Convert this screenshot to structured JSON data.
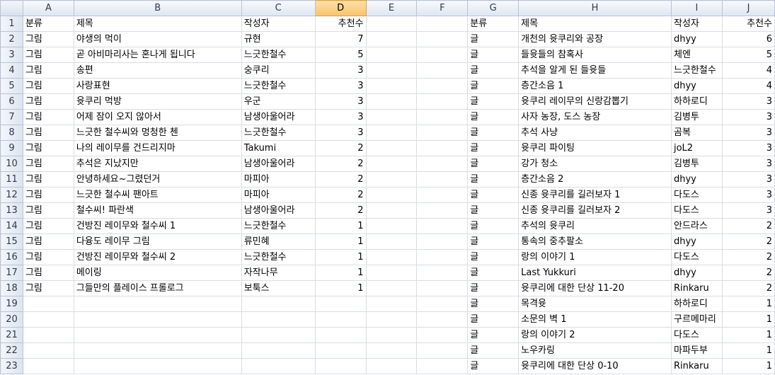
{
  "columns": [
    "A",
    "B",
    "C",
    "D",
    "E",
    "F",
    "G",
    "H",
    "I",
    "J"
  ],
  "selected_column": "D",
  "header_row": {
    "A": "분류",
    "B": "제목",
    "C": "작성자",
    "D": "추천수",
    "G": "분류",
    "H": "제목",
    "I": "작성자",
    "J": "추천수"
  },
  "left_rows": [
    [
      "그림",
      "야생의 먹이",
      "규현",
      "7"
    ],
    [
      "그림",
      "곧 아비마리사는 혼나게 됩니다",
      "느긋한철수",
      "5"
    ],
    [
      "그림",
      "송편",
      "숭쿠리",
      "3"
    ],
    [
      "그림",
      "사랑표현",
      "느긋한철수",
      "3"
    ],
    [
      "그림",
      "윳쿠리 먹방",
      "우군",
      "3"
    ],
    [
      "그림",
      "어제 잠이 오지 않아서",
      "남생아울어라",
      "3"
    ],
    [
      "그림",
      "느긋한 철수씨와 멍청한 첸",
      "느긋한철수",
      "3"
    ],
    [
      "그림",
      "나의 레이무를 건드리지마",
      "Takumi",
      "2"
    ],
    [
      "그림",
      "추석은 지났지만",
      "남생아울어라",
      "2"
    ],
    [
      "그림",
      "안녕하세요~그렸던거",
      "마피아",
      "2"
    ],
    [
      "그림",
      "느긋한 철수씨 팬아트",
      "마피아",
      "2"
    ],
    [
      "그림",
      "철수씨! 파란색",
      "남생아울어라",
      "2"
    ],
    [
      "그림",
      "건방진 레이무와 철수씨 1",
      "느긋한철수",
      "1"
    ],
    [
      "그림",
      "다융도 레이무 그림",
      "류민혜",
      "1"
    ],
    [
      "그림",
      "건방진 레이무와 철수씨 2",
      "느긋한철수",
      "1"
    ],
    [
      "그림",
      "메이링",
      "자작나무",
      "1"
    ],
    [
      "그림",
      "그들만의 플레이스 프롤로그",
      "보툭스",
      "1"
    ]
  ],
  "right_rows": [
    [
      "글",
      "개천의 윳쿠리와 공장",
      "dhyy",
      "6"
    ],
    [
      "글",
      "들윳들의 참혹사",
      "체엔",
      "5"
    ],
    [
      "글",
      "추석을 알게 된 들윳들",
      "느긋한철수",
      "4"
    ],
    [
      "글",
      "층간소음 1",
      "dhyy",
      "4"
    ],
    [
      "글",
      "윳쿠리 레이무의 신랑감뽑기",
      "하하로디",
      "3"
    ],
    [
      "글",
      "사자 농장, 도스 농장",
      "김병투",
      "3"
    ],
    [
      "글",
      "추석 사냥",
      "곰복",
      "3"
    ],
    [
      "글",
      "윳쿠리 파이팅",
      "joL2",
      "3"
    ],
    [
      "글",
      "강가 청소",
      "김병투",
      "3"
    ],
    [
      "글",
      "층간소음 2",
      "dhyy",
      "3"
    ],
    [
      "글",
      "신종 윳쿠리를 길러보자 1",
      "다도스",
      "3"
    ],
    [
      "글",
      "신종 윳쿠리를 길러보자 2",
      "다도스",
      "3"
    ],
    [
      "글",
      "추석의 윳쿠리",
      "안드라스",
      "2"
    ],
    [
      "글",
      "통속의 중추팔소",
      "dhyy",
      "2"
    ],
    [
      "글",
      "랑의 이야기 1",
      "다도스",
      "2"
    ],
    [
      "글",
      "Last Yukkuri",
      "dhyy",
      "2"
    ],
    [
      "글",
      "윳쿠리에 대한 단상 11-20",
      "Rinkaru",
      "2"
    ],
    [
      "글",
      "목격윳",
      "하하로디",
      "1"
    ],
    [
      "글",
      "소문의 벽 1",
      "구르메마리",
      "1"
    ],
    [
      "글",
      "랑의 이야기 2",
      "다도스",
      "1"
    ],
    [
      "글",
      "노우카링",
      "마파두부",
      "1"
    ],
    [
      "글",
      "윳쿠리에 대한 단상 0-10",
      "Rinkaru",
      "1"
    ]
  ]
}
